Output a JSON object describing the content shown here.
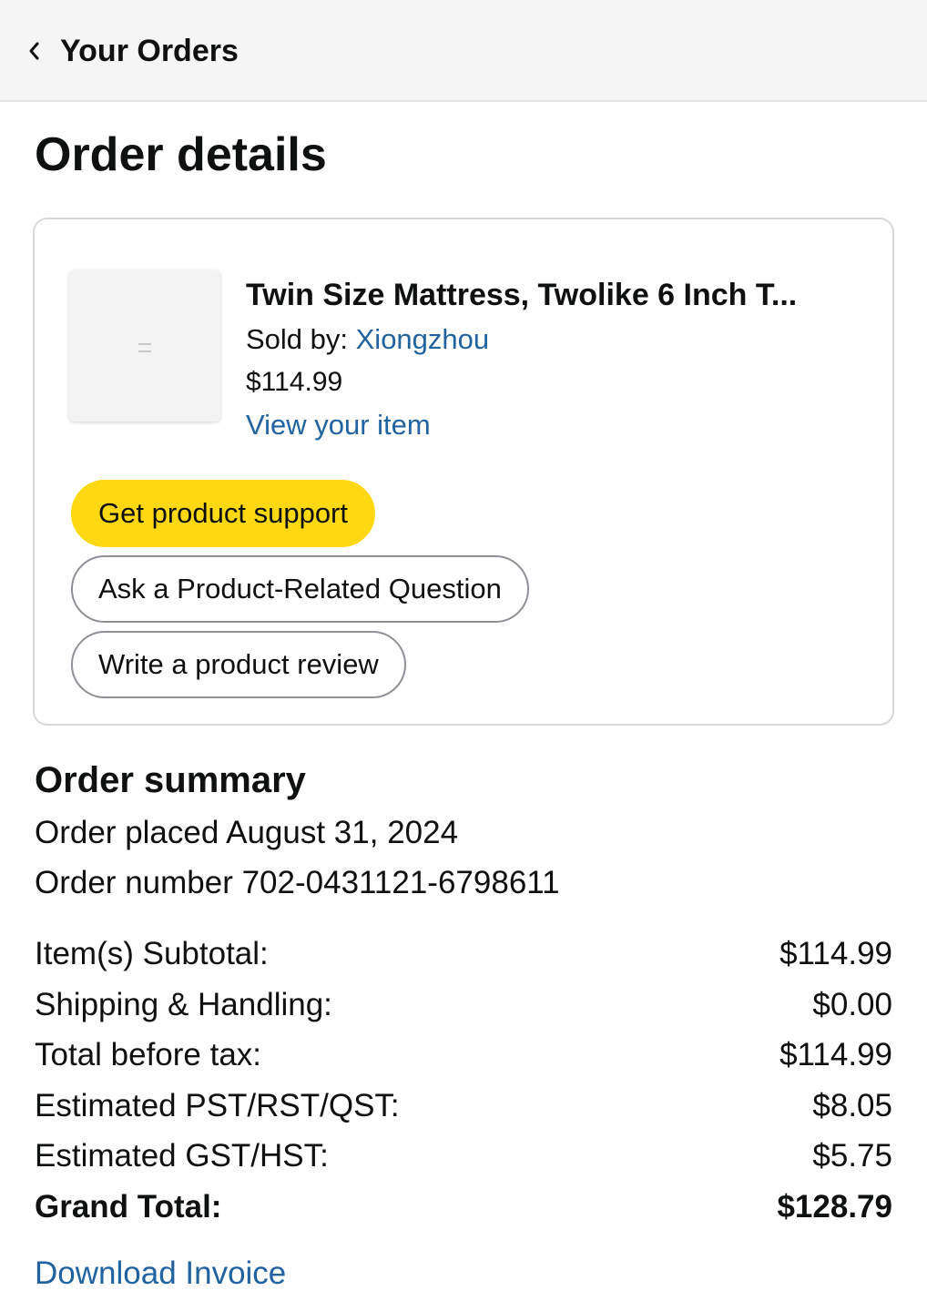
{
  "header": {
    "back_label": "Your Orders",
    "back_icon": "chevron-left-icon"
  },
  "page": {
    "title": "Order details"
  },
  "item": {
    "title": "Twin Size Mattress, Twolike 6 Inch T...",
    "sold_by_prefix": "Sold by: ",
    "seller": "Xiongzhou",
    "price": "$114.99",
    "view_link": "View your item",
    "image_icon": "product-thumbnail"
  },
  "actions": {
    "support": "Get product support",
    "ask": "Ask a Product-Related Question",
    "review": "Write a product review"
  },
  "summary": {
    "title": "Order summary",
    "placed": "Order placed August 31, 2024",
    "number": "Order number 702-0431121-6798611",
    "rows": [
      {
        "label": "Item(s) Subtotal:",
        "value": "$114.99"
      },
      {
        "label": "Shipping & Handling:",
        "value": "$0.00"
      },
      {
        "label": "Total before tax:",
        "value": "$114.99"
      },
      {
        "label": "Estimated PST/RST/QST:",
        "value": "$8.05"
      },
      {
        "label": "Estimated GST/HST:",
        "value": "$5.75"
      }
    ],
    "grand_label": "Grand Total:",
    "grand_value": "$128.79",
    "download": "Download Invoice"
  },
  "colors": {
    "link": "#2162a1",
    "primary_button": "#ffd814",
    "header_bg": "#f5f5f5",
    "text": "#0f1111"
  }
}
